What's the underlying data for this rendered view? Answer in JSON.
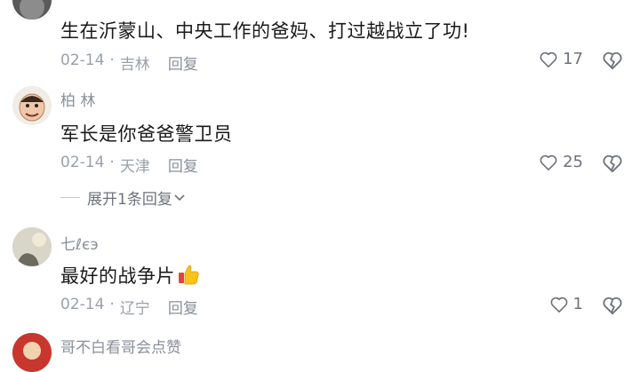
{
  "comments": [
    {
      "username": "",
      "content": "生在沂蒙山、中央工作的爸妈、打过越战立了功!",
      "date": "02-14",
      "location": "吉林",
      "reply_label": "回复",
      "likes": "17",
      "avatar_icon": "user-avatar-icon"
    },
    {
      "username": "柏 林",
      "content": "军长是你爸爸警卫员",
      "date": "02-14",
      "location": "天津",
      "reply_label": "回复",
      "likes": "25",
      "expand_label": "展开1条回复",
      "avatar_icon": "cartoon-face-avatar-icon"
    },
    {
      "username": "七ℓєэ",
      "content": "最好的战争片",
      "date": "02-14",
      "location": "辽宁",
      "reply_label": "回复",
      "likes": "1",
      "emoji": "thumbs-up-emoji",
      "avatar_icon": "silhouette-avatar-icon"
    },
    {
      "username": "哥不白看哥会点赞",
      "avatar_icon": "red-avatar-icon"
    }
  ],
  "separator": "·",
  "colors": {
    "text_primary": "#1a1a1a",
    "text_secondary": "#8a8f99",
    "meta": "#9aa0a8"
  }
}
